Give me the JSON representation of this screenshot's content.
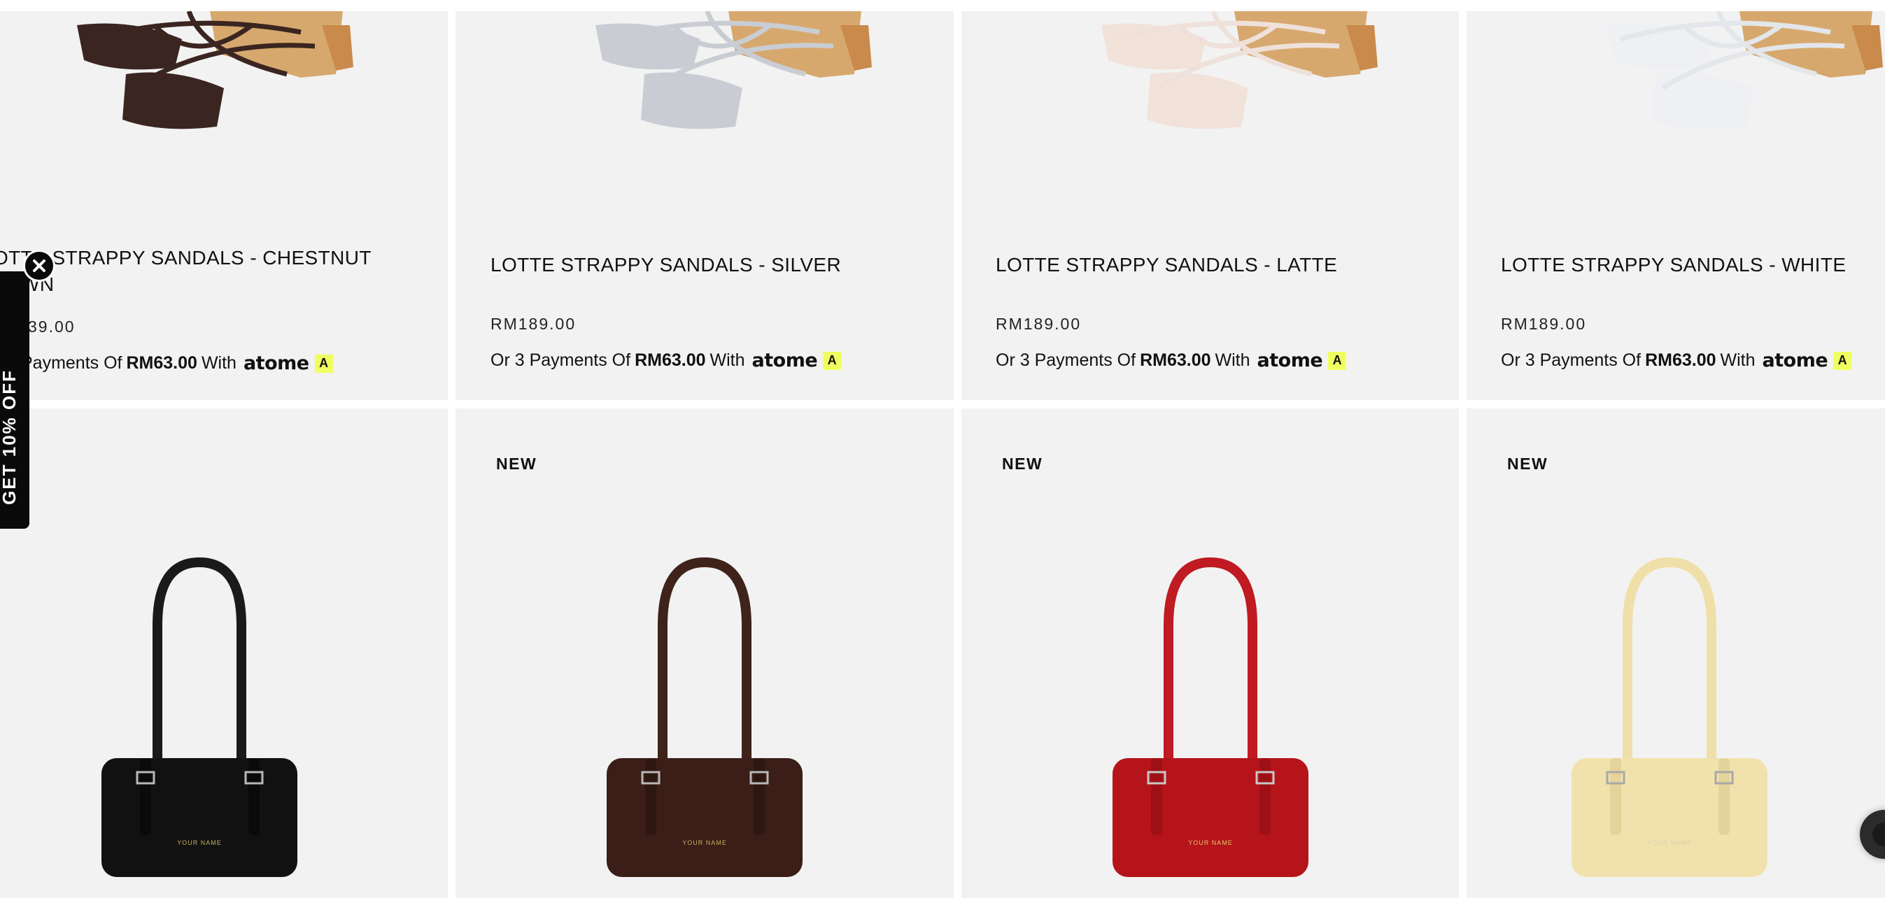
{
  "products": [
    {
      "title": "LOTTE STRAPPY SANDALS - CHESTNUT BROWN",
      "title_line1": "OTTE STRAPPY SANDALS - CHESTNUT",
      "title_line2": "WN",
      "price": "39.00",
      "atome_text_prefix": "Payments Of",
      "atome_amount": "RM63.00",
      "atome_with": "With",
      "atome_brand": "atome",
      "strap_color": "#3a2520",
      "sole_color": "#3a2520"
    },
    {
      "title": "LOTTE STRAPPY SANDALS - SILVER",
      "price": "RM189.00",
      "atome_text_prefix": "Or 3 Payments Of",
      "atome_amount": "RM63.00",
      "atome_with": "With",
      "atome_brand": "atome",
      "strap_color": "#c9cdd3",
      "sole_color": "#c9cdd3"
    },
    {
      "title": "LOTTE STRAPPY SANDALS - LATTE",
      "price": "RM189.00",
      "atome_text_prefix": "Or 3 Payments Of",
      "atome_amount": "RM63.00",
      "atome_with": "With",
      "atome_brand": "atome",
      "strap_color": "#efe1da",
      "sole_color": "#f1e2da"
    },
    {
      "title": "LOTTE STRAPPY SANDALS - WHITE",
      "price": "RM189.00",
      "atome_text_prefix": "Or 3 Payments Of",
      "atome_amount": "RM63.00",
      "atome_with": "With",
      "atome_brand": "atome",
      "strap_color": "#e9ecf0",
      "sole_color": "#eef0f3"
    }
  ],
  "bags": [
    {
      "badge": "",
      "color": "#111111",
      "strap_color": "#1a1a1a",
      "emboss": "YOUR NAME",
      "emboss_color": "#c8b061"
    },
    {
      "badge": "NEW",
      "color": "#3b1e17",
      "strap_color": "#3f231b",
      "emboss": "YOUR NAME",
      "emboss_color": "#c8b061"
    },
    {
      "badge": "NEW",
      "color": "#b5141b",
      "strap_color": "#c01a22",
      "emboss": "YOUR NAME",
      "emboss_color": "#e6c36b"
    },
    {
      "badge": "NEW",
      "color": "#f1e2ad",
      "strap_color": "#efdfa8",
      "emboss": "YOUR NAME",
      "emboss_color": "#d9cfae"
    }
  ],
  "side_tab": {
    "label": "GET 10% OFF"
  },
  "icons": {
    "close": "close-icon",
    "chat": "chat-icon"
  },
  "colors": {
    "atome_badge": "#f0ff5f",
    "card_bg": "#f2f2f2"
  }
}
